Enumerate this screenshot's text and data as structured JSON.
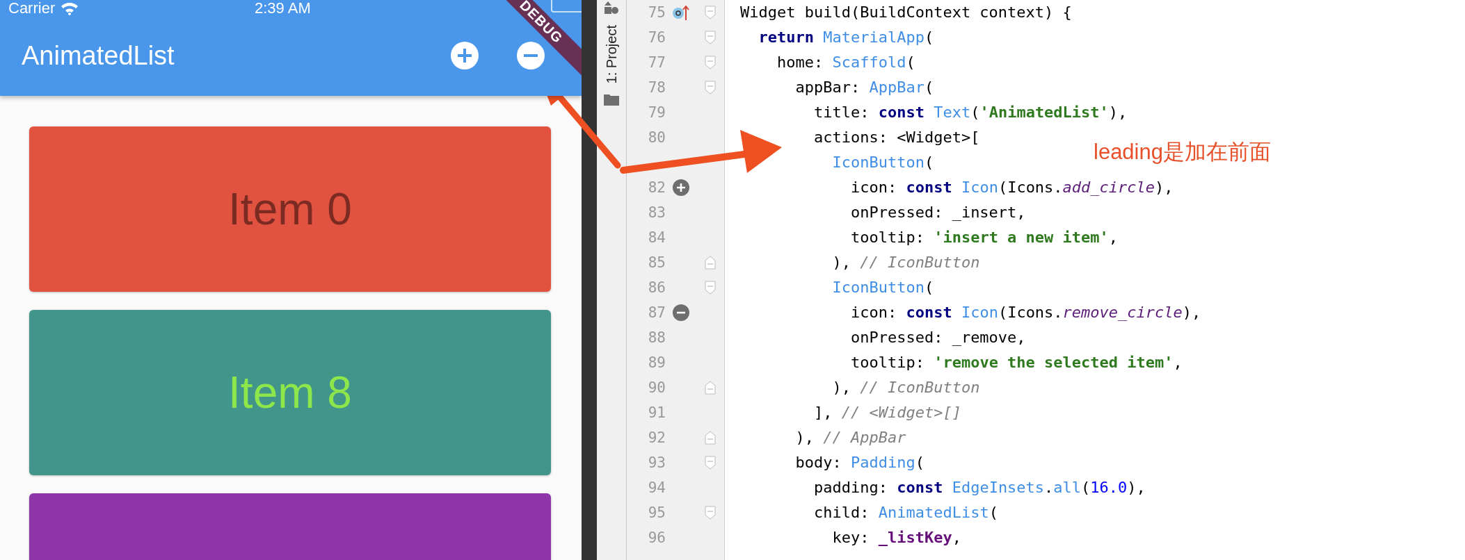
{
  "phone": {
    "status_bar": {
      "carrier": "Carrier",
      "time": "2:39 AM"
    },
    "debug_banner": "DEBUG",
    "app_bar": {
      "title": "AnimatedList",
      "actions": [
        {
          "kind": "add"
        },
        {
          "kind": "remove"
        }
      ]
    },
    "cards": [
      {
        "color": "#e25241",
        "label": {
          "text": "Item 0",
          "color": "#7b2b22"
        }
      },
      {
        "color": "#41958a",
        "label": {
          "text": "Item 8",
          "color": "#8ee74a"
        }
      },
      {
        "color": "#8e35a9"
      }
    ]
  },
  "tool_strip": {
    "label": "1: Project"
  },
  "editor": {
    "lines": [
      {
        "number": "75",
        "override_marker": true,
        "fold_start": true,
        "tokens": [
          {
            "kind": "plain",
            "text": "Widget build(BuildContext context) {"
          }
        ]
      },
      {
        "number": "76",
        "fold_start": true,
        "tokens": [
          {
            "kind": "kw",
            "text": "  return"
          },
          {
            "kind": "type",
            "text": " MaterialApp"
          },
          {
            "kind": "plain",
            "text": "("
          }
        ]
      },
      {
        "number": "77",
        "fold_start": true,
        "tokens": [
          {
            "kind": "plain",
            "text": "    home: "
          },
          {
            "kind": "type",
            "text": "Scaffold"
          },
          {
            "kind": "plain",
            "text": "("
          }
        ]
      },
      {
        "number": "78",
        "fold_start": true,
        "tokens": [
          {
            "kind": "plain",
            "text": "      appBar: "
          },
          {
            "kind": "type",
            "text": "AppBar"
          },
          {
            "kind": "plain",
            "text": "("
          }
        ]
      },
      {
        "number": "79",
        "tokens": [
          {
            "kind": "plain",
            "text": "        title: "
          },
          {
            "kind": "kw",
            "text": "const"
          },
          {
            "kind": "type",
            "text": " Text"
          },
          {
            "kind": "plain",
            "text": "("
          },
          {
            "kind": "str",
            "text": "'AnimatedList'"
          },
          {
            "kind": "plain",
            "text": "),"
          }
        ]
      },
      {
        "number": "80",
        "tokens": [
          {
            "kind": "plain",
            "text": "        actions: <Widget>["
          }
        ]
      },
      {
        "tokens": [
          {
            "kind": "type",
            "text": "          IconButton"
          },
          {
            "kind": "plain",
            "text": "("
          }
        ]
      },
      {
        "number": "82",
        "add_marker": true,
        "tokens": [
          {
            "kind": "plain",
            "text": "            icon: "
          },
          {
            "kind": "kw",
            "text": "const"
          },
          {
            "kind": "type",
            "text": " Icon"
          },
          {
            "kind": "plain",
            "text": "(Icons."
          },
          {
            "kind": "ident",
            "text": "add_circle"
          },
          {
            "kind": "plain",
            "text": "),"
          }
        ]
      },
      {
        "number": "83",
        "tokens": [
          {
            "kind": "plain",
            "text": "            onPressed: _insert,"
          }
        ]
      },
      {
        "number": "84",
        "tokens": [
          {
            "kind": "plain",
            "text": "            tooltip: "
          },
          {
            "kind": "str",
            "text": "'insert a new item'"
          },
          {
            "kind": "plain",
            "text": ","
          }
        ]
      },
      {
        "number": "85",
        "fold_end": true,
        "tokens": [
          {
            "kind": "plain",
            "text": "          ), "
          },
          {
            "kind": "comment",
            "text": "// IconButton"
          }
        ]
      },
      {
        "number": "86",
        "fold_start": true,
        "tokens": [
          {
            "kind": "type",
            "text": "          IconButton"
          },
          {
            "kind": "plain",
            "text": "("
          }
        ]
      },
      {
        "number": "87",
        "remove_marker": true,
        "tokens": [
          {
            "kind": "plain",
            "text": "            icon: "
          },
          {
            "kind": "kw",
            "text": "const"
          },
          {
            "kind": "type",
            "text": " Icon"
          },
          {
            "kind": "plain",
            "text": "(Icons."
          },
          {
            "kind": "ident",
            "text": "remove_circle"
          },
          {
            "kind": "plain",
            "text": "),"
          }
        ]
      },
      {
        "number": "88",
        "tokens": [
          {
            "kind": "plain",
            "text": "            onPressed: _remove,"
          }
        ]
      },
      {
        "number": "89",
        "tokens": [
          {
            "kind": "plain",
            "text": "            tooltip: "
          },
          {
            "kind": "str",
            "text": "'remove the selected item'"
          },
          {
            "kind": "plain",
            "text": ","
          }
        ]
      },
      {
        "number": "90",
        "fold_end": true,
        "tokens": [
          {
            "kind": "plain",
            "text": "          ), "
          },
          {
            "kind": "comment",
            "text": "// IconButton"
          }
        ]
      },
      {
        "number": "91",
        "tokens": [
          {
            "kind": "plain",
            "text": "        ], "
          },
          {
            "kind": "comment",
            "text": "// <Widget>[]"
          }
        ]
      },
      {
        "number": "92",
        "fold_end": true,
        "tokens": [
          {
            "kind": "plain",
            "text": "      ), "
          },
          {
            "kind": "comment",
            "text": "// AppBar"
          }
        ]
      },
      {
        "number": "93",
        "fold_start": true,
        "tokens": [
          {
            "kind": "plain",
            "text": "      body: "
          },
          {
            "kind": "type",
            "text": "Padding"
          },
          {
            "kind": "plain",
            "text": "("
          }
        ]
      },
      {
        "number": "94",
        "tokens": [
          {
            "kind": "plain",
            "text": "        padding: "
          },
          {
            "kind": "kw",
            "text": "const"
          },
          {
            "kind": "type",
            "text": " EdgeInsets"
          },
          {
            "kind": "plain",
            "text": "."
          },
          {
            "kind": "type",
            "text": "all"
          },
          {
            "kind": "plain",
            "text": "("
          },
          {
            "kind": "num",
            "text": "16.0"
          },
          {
            "kind": "plain",
            "text": "),"
          }
        ]
      },
      {
        "number": "95",
        "fold_start": true,
        "tokens": [
          {
            "kind": "plain",
            "text": "        child: "
          },
          {
            "kind": "type",
            "text": "AnimatedList"
          },
          {
            "kind": "plain",
            "text": "("
          }
        ]
      },
      {
        "number": "96",
        "tokens": [
          {
            "kind": "plain",
            "text": "          key: "
          },
          {
            "kind": "field",
            "text": "_listKey"
          },
          {
            "kind": "plain",
            "text": ","
          }
        ]
      }
    ]
  },
  "annotation": "leading是加在前面"
}
